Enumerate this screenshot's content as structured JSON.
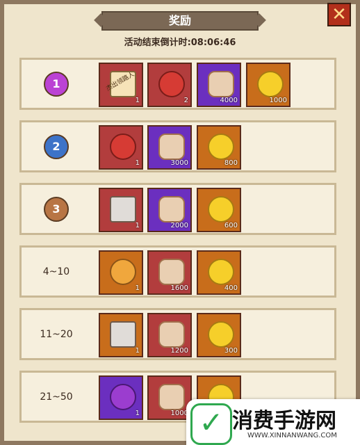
{
  "title": "奖励",
  "countdown": "活动结束倒计时:08:06:46",
  "close_icon": "✕",
  "rows": [
    {
      "rank": "1",
      "medal": "m1",
      "items": [
        {
          "type": "scroll",
          "color": "red",
          "qty": "1",
          "label": "杰出领路人"
        },
        {
          "type": "redbag",
          "color": "red",
          "qty": "2"
        },
        {
          "type": "sack",
          "color": "purple",
          "qty": "4000"
        },
        {
          "type": "coin",
          "color": "orange",
          "qty": "1000"
        }
      ]
    },
    {
      "rank": "2",
      "medal": "m2",
      "items": [
        {
          "type": "redbag",
          "color": "red",
          "qty": "1"
        },
        {
          "type": "sack",
          "color": "purple",
          "qty": "3000"
        },
        {
          "type": "coin",
          "color": "orange",
          "qty": "800"
        }
      ]
    },
    {
      "rank": "3",
      "medal": "m3",
      "items": [
        {
          "type": "box",
          "color": "red",
          "qty": "1"
        },
        {
          "type": "sack",
          "color": "purple",
          "qty": "2000"
        },
        {
          "type": "coin",
          "color": "orange",
          "qty": "600"
        }
      ]
    },
    {
      "rank": "4~10",
      "medal": "",
      "items": [
        {
          "type": "orangebag",
          "color": "orange",
          "qty": "1"
        },
        {
          "type": "sack",
          "color": "red",
          "qty": "1600"
        },
        {
          "type": "coin",
          "color": "orange",
          "qty": "400"
        }
      ]
    },
    {
      "rank": "11~20",
      "medal": "",
      "items": [
        {
          "type": "box",
          "color": "orange",
          "qty": "1"
        },
        {
          "type": "sack",
          "color": "red",
          "qty": "1200"
        },
        {
          "type": "coin",
          "color": "orange",
          "qty": "300"
        }
      ]
    },
    {
      "rank": "21~50",
      "medal": "",
      "items": [
        {
          "type": "purplebag",
          "color": "purple",
          "qty": "1"
        },
        {
          "type": "sack",
          "color": "red",
          "qty": "1000"
        },
        {
          "type": "coin",
          "color": "orange",
          "qty": ""
        }
      ]
    }
  ],
  "watermark": {
    "logo": "✓",
    "text": "消费手游网",
    "url": "WWW.XINNANWANG.COM"
  }
}
